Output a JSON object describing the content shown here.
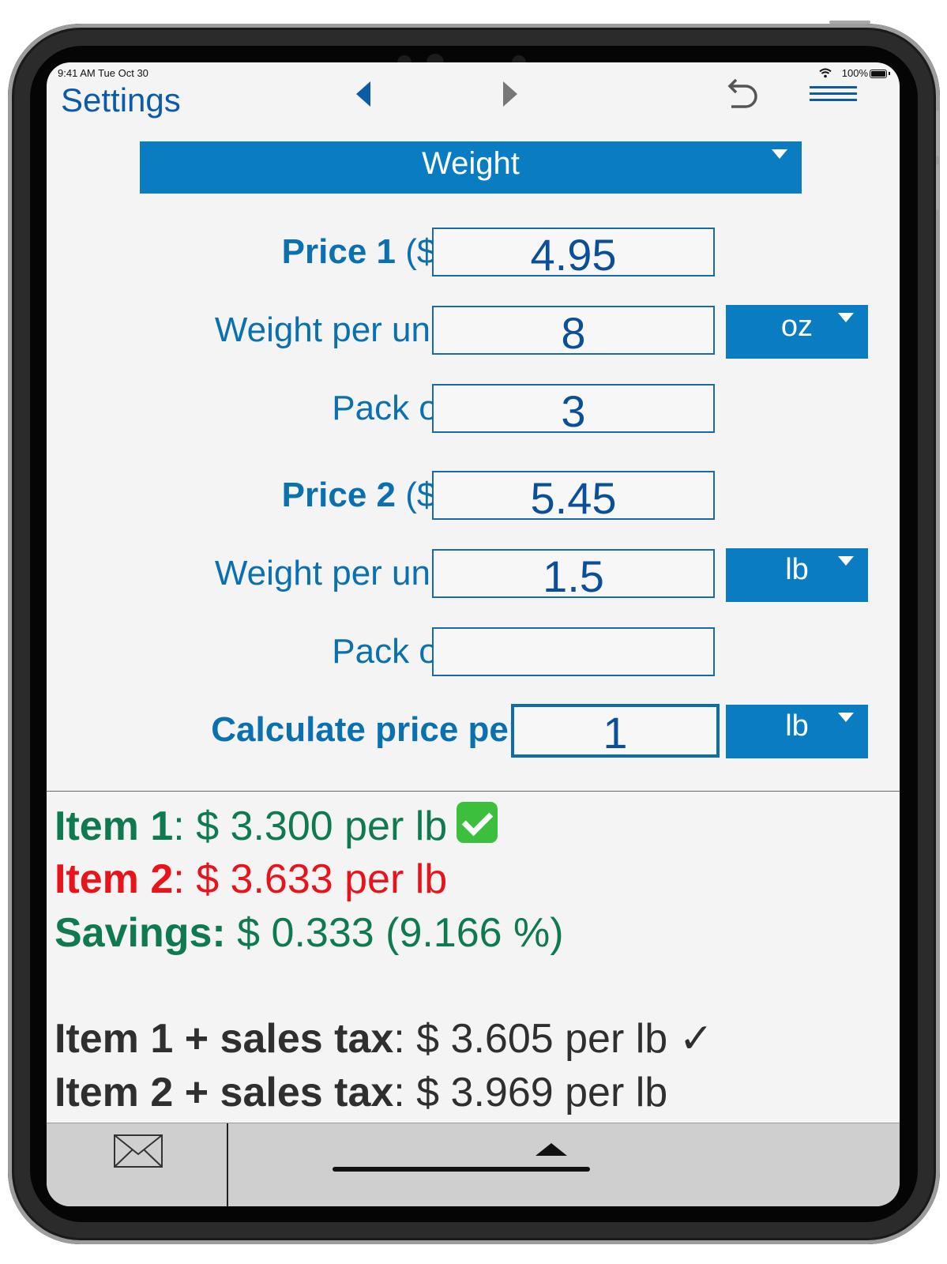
{
  "status_bar": {
    "time_date": "9:41 AM  Tue Oct 30",
    "battery": "100%"
  },
  "nav": {
    "settings_label": "Settings"
  },
  "category": {
    "selected": "Weight"
  },
  "item1": {
    "price_label_bold": "Price 1",
    "price_label_unit": " ($)",
    "price_value": "4.95",
    "weight_label": "Weight per unit",
    "weight_value": "8",
    "weight_unit": "oz",
    "pack_label": "Pack of",
    "pack_value": "3"
  },
  "item2": {
    "price_label_bold": "Price 2",
    "price_label_unit": " ($)",
    "price_value": "5.45",
    "weight_label": "Weight per unit",
    "weight_value": "1.5",
    "weight_unit": "lb",
    "pack_label": "Pack of",
    "pack_value": ""
  },
  "calculate": {
    "label": "Calculate price per",
    "value": "1",
    "unit": "lb"
  },
  "results": {
    "item1_label": "Item 1",
    "item1_value": ": $ 3.300 per lb",
    "item2_label": "Item 2",
    "item2_value": ": $ 3.633 per lb",
    "savings_label": "Savings:",
    "savings_value": " $ 0.333 (9.166 %)",
    "item1_tax_label": "Item 1 + sales tax",
    "item1_tax_value": ": $ 3.605 per lb ✓",
    "item2_tax_label": "Item 2 + sales tax",
    "item2_tax_value": ": $ 3.969 per lb"
  },
  "colors": {
    "accent_blue": "#0a7cc2",
    "best_green": "#0f7a50",
    "worse_red": "#e8131b"
  },
  "icons": [
    "back-arrow-icon",
    "forward-arrow-icon",
    "undo-icon",
    "menu-icon",
    "mail-icon",
    "expand-up-icon",
    "wifi-icon",
    "battery-icon"
  ]
}
